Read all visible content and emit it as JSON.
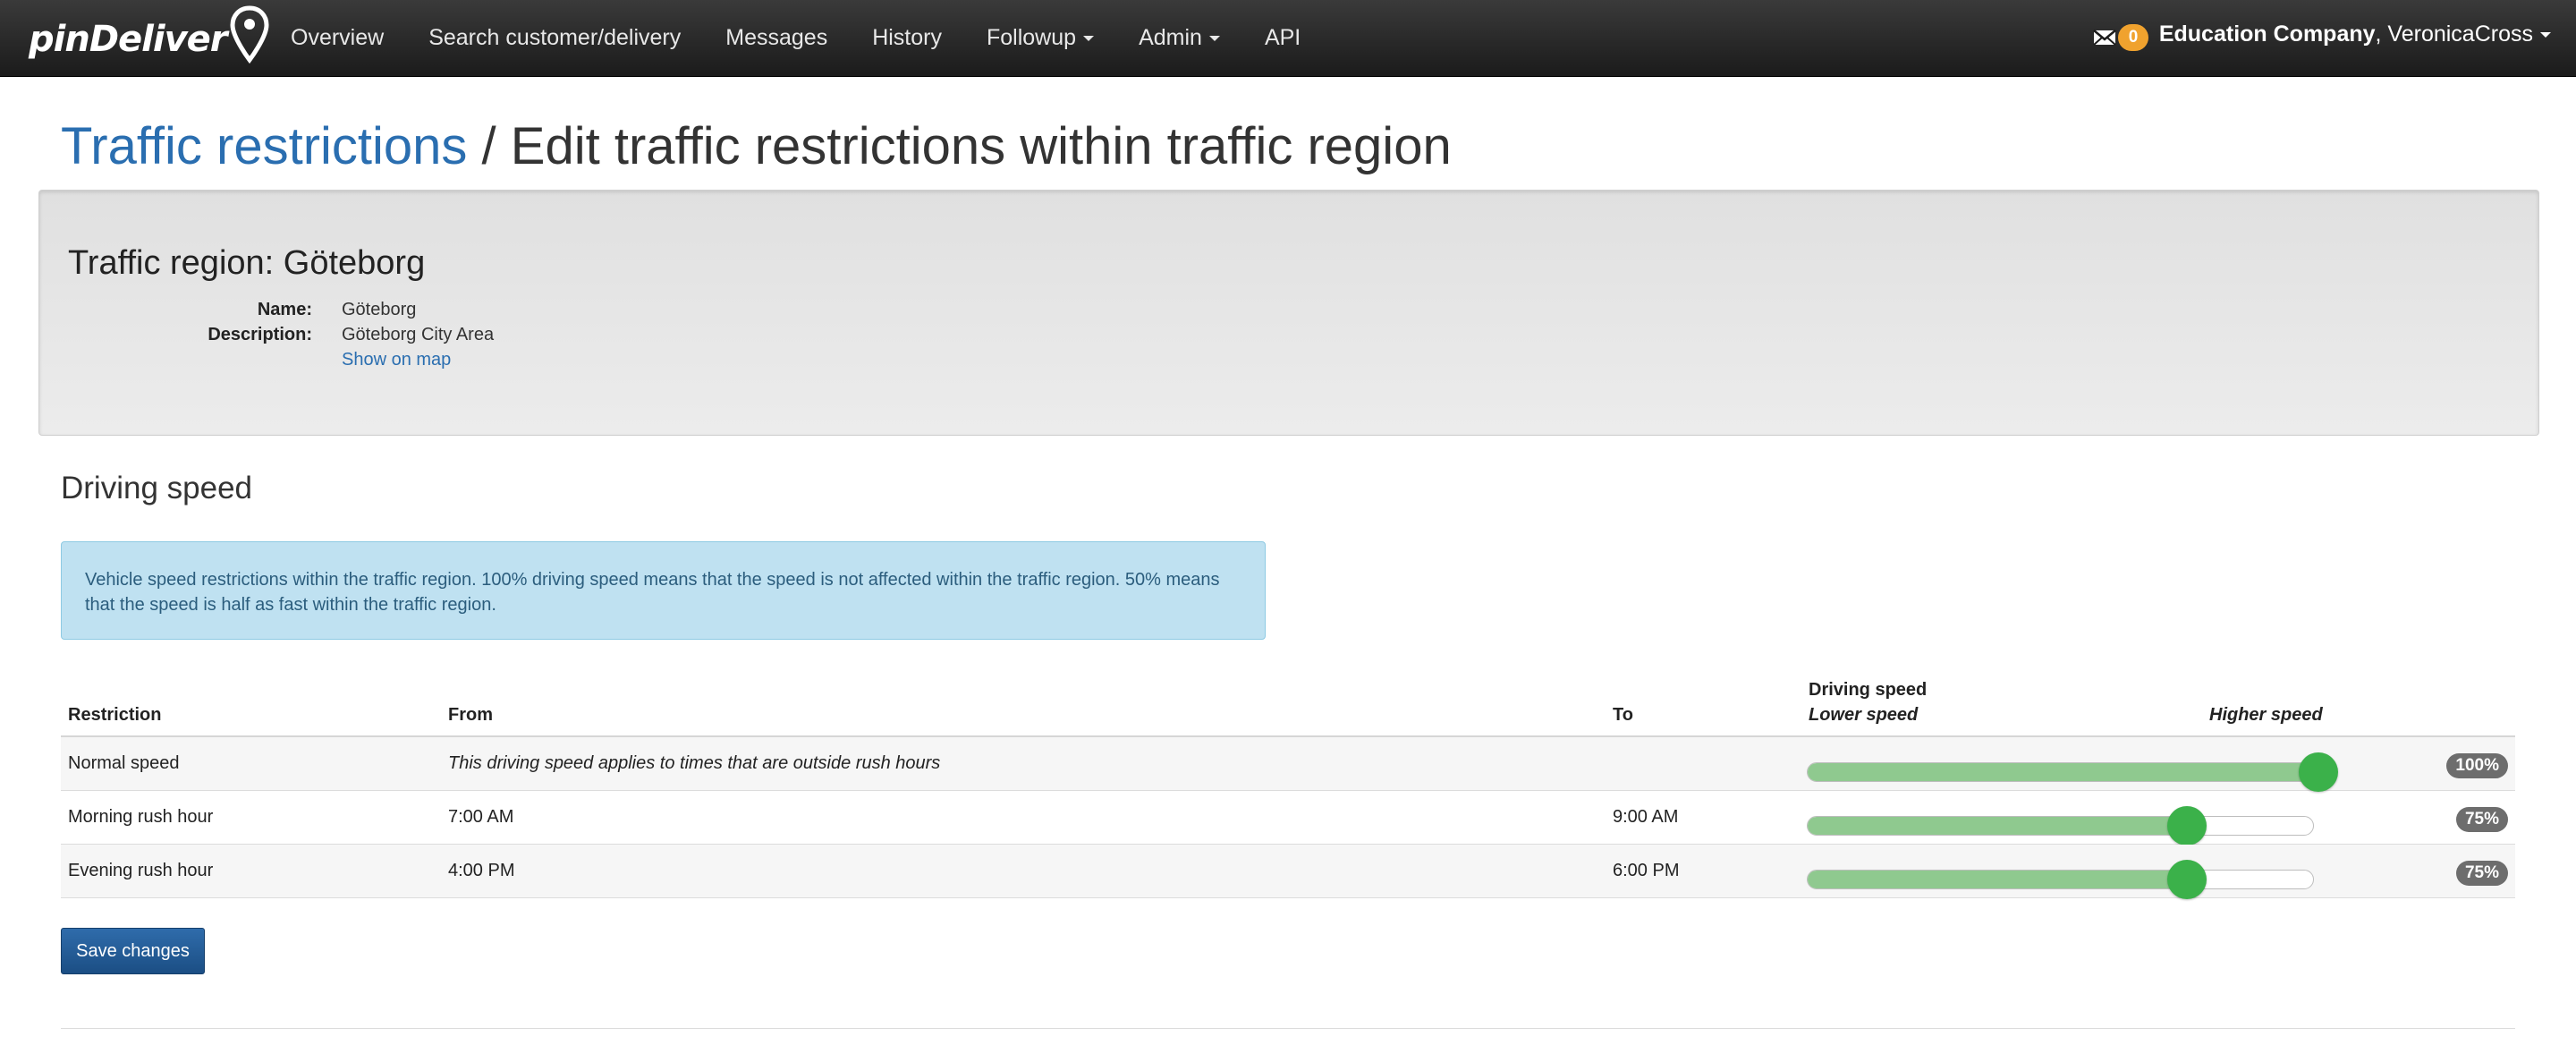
{
  "nav": {
    "brand": "pinDeliver",
    "links": [
      "Overview",
      "Search customer/delivery",
      "Messages",
      "History",
      "Followup",
      "Admin",
      "API"
    ],
    "mail_count": "0",
    "company": "Education Company",
    "user": ", VeronicaCross"
  },
  "page": {
    "breadcrumb_link": "Traffic restrictions",
    "separator": " / ",
    "title": "Edit traffic restrictions within traffic region"
  },
  "region": {
    "heading": "Traffic region: Göteborg",
    "name_label": "Name:",
    "name": "Göteborg",
    "description_label": "Description:",
    "description": "Göteborg City Area",
    "map_link": "Show on map"
  },
  "driving_speed": {
    "title": "Driving speed",
    "info": "Vehicle speed restrictions within the traffic region. 100% driving speed means that the speed is not affected within the traffic region. 50% means that the speed is half as fast within the traffic region."
  },
  "table": {
    "headers": {
      "restriction": "Restriction",
      "from": "From",
      "to": "To",
      "driving_speed": "Driving speed",
      "lower": "Lower speed",
      "higher": "Higher speed"
    },
    "rows": [
      {
        "restriction": "Normal speed",
        "from": "This driving speed applies to times that are outside rush hours",
        "to": "",
        "speed_fraction": 1.0,
        "percent": "100%"
      },
      {
        "restriction": "Morning rush hour",
        "from": "7:00 AM",
        "to": "9:00 AM",
        "speed_fraction": 0.75,
        "percent": "75%"
      },
      {
        "restriction": "Evening rush hour",
        "from": "4:00 PM",
        "to": "6:00 PM",
        "speed_fraction": 0.75,
        "percent": "75%"
      }
    ]
  },
  "actions": {
    "save": "Save changes"
  }
}
